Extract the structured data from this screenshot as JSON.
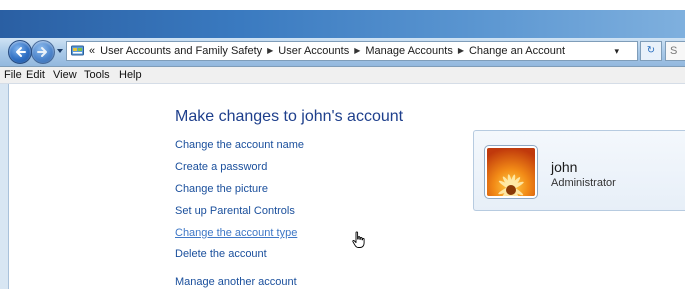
{
  "colors": {
    "title_band": "#2a5fa3",
    "nav_bar": "#a9c9e8",
    "link": "#1a4f9c",
    "link_hover": "#3e77c6",
    "heading": "#1e3f8c"
  },
  "nav": {
    "back_icon": "back-arrow-icon",
    "forward_icon": "forward-arrow-icon",
    "address": {
      "overflow": "«",
      "crumbs": [
        "User Accounts and Family Safety",
        "User Accounts",
        "Manage Accounts",
        "Change an Account"
      ],
      "separator": "▶",
      "dropdown": "▾",
      "refresh": "↻",
      "search_stub": "S"
    }
  },
  "menu": [
    "File",
    "Edit",
    "View",
    "Tools",
    "Help"
  ],
  "main": {
    "title": "Make changes to john's account",
    "tasks": [
      "Change the account name",
      "Create a password",
      "Change the picture",
      "Set up Parental Controls",
      "Change the account type",
      "Delete the account",
      "Manage another account"
    ],
    "hovered_task_index": 4
  },
  "account": {
    "name": "john",
    "role": "Administrator",
    "picture": "flower-picture"
  }
}
